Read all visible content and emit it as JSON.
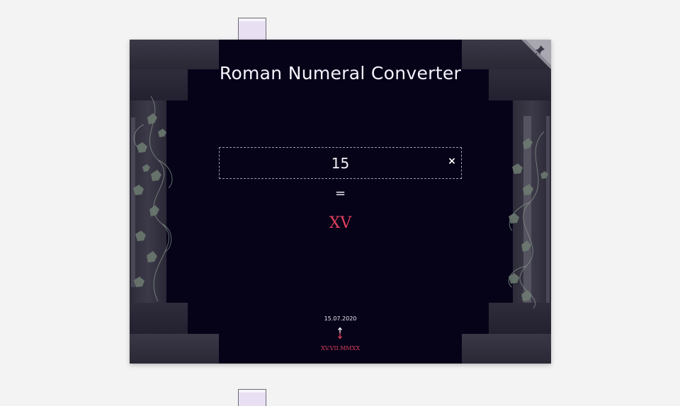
{
  "app": {
    "title": "Roman Numeral Converter"
  },
  "converter": {
    "input_value": "15",
    "clear_label": "×",
    "equals": "=",
    "result": "XV"
  },
  "footer": {
    "date": "15.07.2020",
    "roman_date": "XV.VII.MMXX"
  },
  "icons": [
    "pin-icon",
    "vine-decoration-icon",
    "up-down-arrow-icon",
    "close-icon"
  ],
  "colors": {
    "background": "#060319",
    "accent_red": "#e0405c",
    "text": "#f5f3fb",
    "page": "#f3f3f3"
  }
}
